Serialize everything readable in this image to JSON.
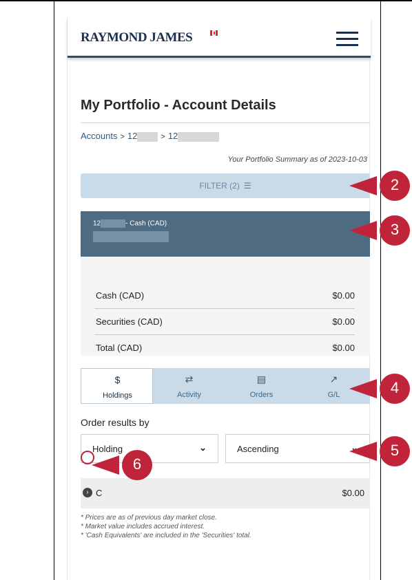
{
  "header": {
    "brand": "RAYMOND JAMES"
  },
  "page": {
    "title": "My Portfolio - Account Details"
  },
  "breadcrumb": {
    "root": "Accounts",
    "sep": ">",
    "acct1_prefix": "12",
    "acct2_prefix": "12"
  },
  "summary": {
    "as_of": "Your Portfolio Summary as of 2023-10-03"
  },
  "filter": {
    "label": "FILTER (2)",
    "icon": "sliders-icon"
  },
  "account": {
    "title_prefix": "12",
    "title_suffix": "- Cash (CAD)"
  },
  "balances": [
    {
      "label": "Cash (CAD)",
      "value": "$0.00"
    },
    {
      "label": "Securities (CAD)",
      "value": "$0.00"
    },
    {
      "label": "Total (CAD)",
      "value": "$0.00"
    }
  ],
  "tabs": [
    {
      "label": "Holdings",
      "icon": "hand-dollar-icon",
      "glyph": "$",
      "active": true
    },
    {
      "label": "Activity",
      "icon": "swap-arrows-icon",
      "glyph": "⇄",
      "active": false
    },
    {
      "label": "Orders",
      "icon": "list-icon",
      "glyph": "▤",
      "active": false
    },
    {
      "label": "G/L",
      "icon": "trend-arrow-icon",
      "glyph": "↗",
      "active": false
    }
  ],
  "order": {
    "label": "Order results by",
    "sort_field": "Holding",
    "sort_direction": "Ascending"
  },
  "holding": {
    "name": "C",
    "value": "$0.00"
  },
  "notes": [
    "* Prices are as of previous day market close.",
    "* Market value includes accrued interest.",
    "* 'Cash Equivalents' are included in the 'Securities' total."
  ],
  "callouts": [
    "2",
    "3",
    "4",
    "5",
    "6"
  ],
  "colors": {
    "accent_red": "#c0243a",
    "navy": "#1c2f4f",
    "tab_bg": "#c9dbe9",
    "account_bar": "#4f6b82"
  }
}
